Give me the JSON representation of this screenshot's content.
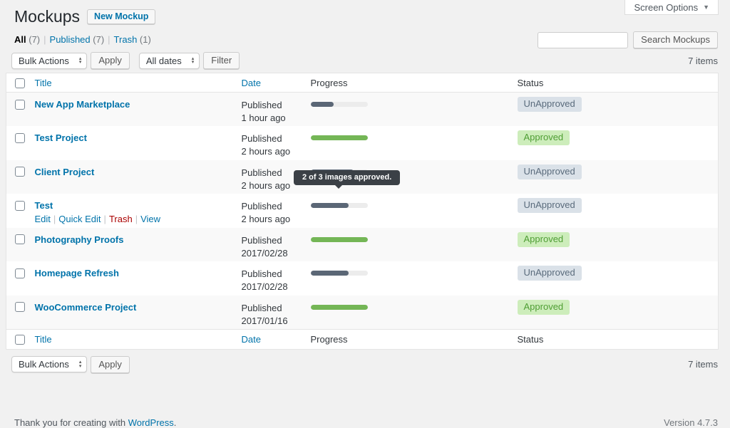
{
  "header": {
    "title": "Mockups",
    "new_button": "New Mockup",
    "screen_options": "Screen Options"
  },
  "icons": {
    "caret_down": "▼",
    "select_caret_up": "▴",
    "select_caret_down": "▾"
  },
  "views": {
    "separator": "|",
    "items": [
      {
        "label": "All",
        "count": "(7)",
        "current": true
      },
      {
        "label": "Published",
        "count": "(7)",
        "current": false
      },
      {
        "label": "Trash",
        "count": "(1)",
        "current": false
      }
    ]
  },
  "search": {
    "value": "",
    "button_label": "Search Mockups"
  },
  "toolbar_top": {
    "bulk_actions_label": "Bulk Actions",
    "apply_label": "Apply",
    "dates_filter_label": "All dates",
    "filter_label": "Filter",
    "items_count": "7 items"
  },
  "toolbar_bottom": {
    "bulk_actions_label": "Bulk Actions",
    "apply_label": "Apply",
    "items_count": "7 items"
  },
  "table": {
    "columns": {
      "title": "Title",
      "date": "Date",
      "progress": "Progress",
      "status": "Status"
    },
    "actions_separator": "|",
    "rows": [
      {
        "title": "New App Marketplace",
        "date_line1": "Published",
        "date_line2": "1 hour ago",
        "progress_pct": 40,
        "progress_color": "gray",
        "status": "UnApproved"
      },
      {
        "title": "Test Project",
        "date_line1": "Published",
        "date_line2": "2 hours ago",
        "progress_pct": 100,
        "progress_color": "green",
        "status": "Approved"
      },
      {
        "title": "Client Project",
        "date_line1": "Published",
        "date_line2": "2 hours ago",
        "progress_pct": 76,
        "progress_color": "gray",
        "status": "UnApproved"
      },
      {
        "title": "Test",
        "date_line1": "Published",
        "date_line2": "2 hours ago",
        "progress_pct": 67,
        "progress_color": "gray",
        "status": "UnApproved",
        "actions": [
          {
            "label": "Edit",
            "style": "link"
          },
          {
            "label": "Quick Edit",
            "style": "link"
          },
          {
            "label": "Trash",
            "style": "danger"
          },
          {
            "label": "View",
            "style": "link"
          }
        ]
      },
      {
        "title": "Photography Proofs",
        "date_line1": "Published",
        "date_line2": "2017/02/28",
        "progress_pct": 100,
        "progress_color": "green",
        "status": "Approved"
      },
      {
        "title": "Homepage Refresh",
        "date_line1": "Published",
        "date_line2": "2017/02/28",
        "progress_pct": 67,
        "progress_color": "gray",
        "status": "UnApproved"
      },
      {
        "title": "WooCommerce Project",
        "date_line1": "Published",
        "date_line2": "2017/01/16",
        "progress_pct": 100,
        "progress_color": "green",
        "status": "Approved"
      }
    ]
  },
  "tooltip": {
    "text": "2 of 3 images approved."
  },
  "footer": {
    "thanks_prefix": "Thank you for creating with ",
    "wordpress_link": "WordPress",
    "thanks_suffix": ".",
    "version": "Version 4.7.3"
  },
  "colors": {
    "accent_blue": "#0073aa",
    "page_background": "#f1f1f1",
    "row_stripe": "#f9f9f9",
    "progress_track": "#ececec",
    "gray": "#5b6776",
    "green": "#74b656",
    "badge_unapproved_bg": "#dae1e8",
    "badge_unapproved_text": "#5a6b7c",
    "badge_approved_bg": "#cdedbb",
    "badge_approved_text": "#4f9e34",
    "tooltip_bg": "#3b4046",
    "trash_red": "#a00"
  }
}
